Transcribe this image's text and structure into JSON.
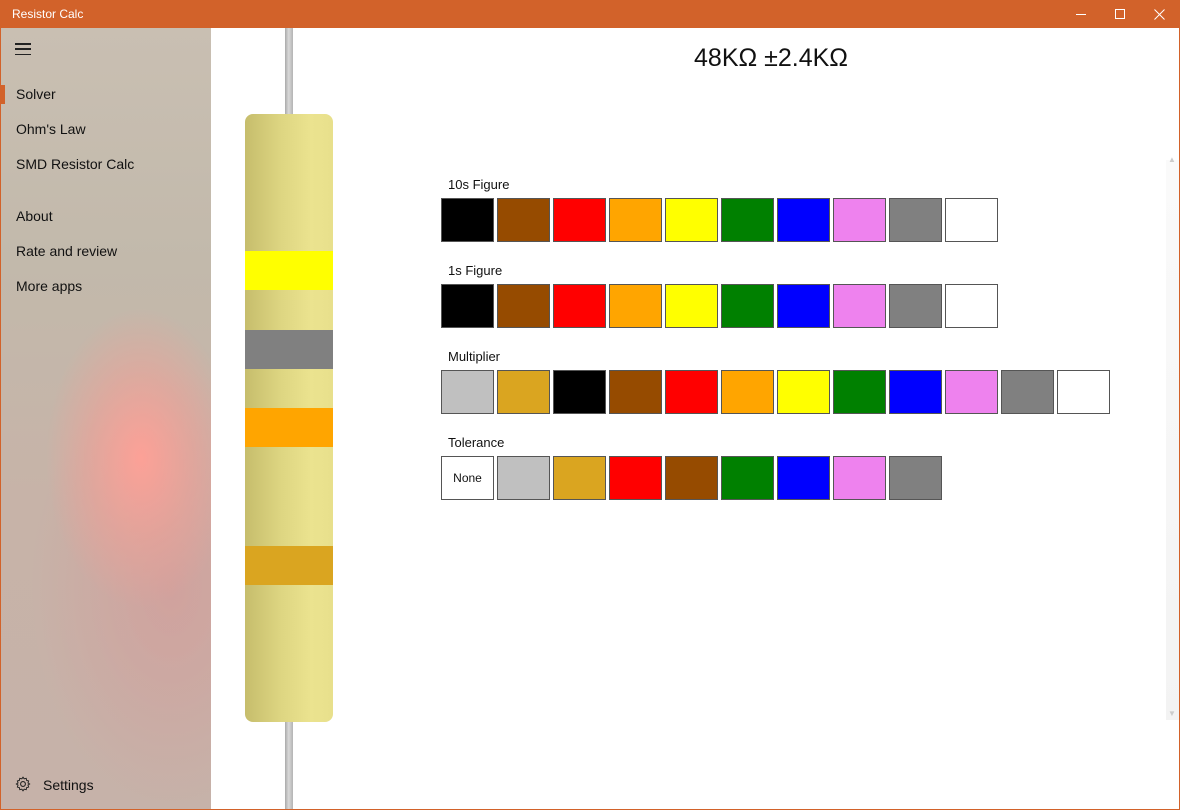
{
  "window": {
    "title": "Resistor Calc",
    "accent_color": "#d2622a"
  },
  "nav": {
    "menu_icon": "hamburger-icon",
    "items": [
      {
        "label": "Solver",
        "selected": true
      },
      {
        "label": "Ohm's Law",
        "selected": false
      },
      {
        "label": "SMD Resistor Calc",
        "selected": false
      },
      {
        "label": "About",
        "selected": false
      },
      {
        "label": "Rate and review",
        "selected": false
      },
      {
        "label": "More apps",
        "selected": false
      }
    ],
    "settings": {
      "label": "Settings",
      "icon": "gear-icon"
    }
  },
  "result": {
    "text": "48KΩ ±2.4KΩ"
  },
  "resistor": {
    "body_color": "#e5dd8a",
    "bands": [
      {
        "name": "tens",
        "color": "#ffff00"
      },
      {
        "name": "ones",
        "color": "#808080"
      },
      {
        "name": "multiplier",
        "color": "#ffa500"
      },
      {
        "name": "tolerance",
        "color": "#daa520"
      }
    ]
  },
  "groups": {
    "tens": {
      "label": "10s Figure",
      "swatches": [
        {
          "name": "black",
          "color": "#000000"
        },
        {
          "name": "brown",
          "color": "#964b00"
        },
        {
          "name": "red",
          "color": "#ff0000"
        },
        {
          "name": "orange",
          "color": "#ffa500"
        },
        {
          "name": "yellow",
          "color": "#ffff00"
        },
        {
          "name": "green",
          "color": "#008000"
        },
        {
          "name": "blue",
          "color": "#0000ff"
        },
        {
          "name": "violet",
          "color": "#ee82ee"
        },
        {
          "name": "gray",
          "color": "#808080"
        },
        {
          "name": "white",
          "color": "#ffffff"
        }
      ]
    },
    "ones": {
      "label": "1s Figure",
      "swatches": [
        {
          "name": "black",
          "color": "#000000"
        },
        {
          "name": "brown",
          "color": "#964b00"
        },
        {
          "name": "red",
          "color": "#ff0000"
        },
        {
          "name": "orange",
          "color": "#ffa500"
        },
        {
          "name": "yellow",
          "color": "#ffff00"
        },
        {
          "name": "green",
          "color": "#008000"
        },
        {
          "name": "blue",
          "color": "#0000ff"
        },
        {
          "name": "violet",
          "color": "#ee82ee"
        },
        {
          "name": "gray",
          "color": "#808080"
        },
        {
          "name": "white",
          "color": "#ffffff"
        }
      ]
    },
    "multiplier": {
      "label": "Multiplier",
      "swatches": [
        {
          "name": "silver",
          "color": "#c0c0c0"
        },
        {
          "name": "gold",
          "color": "#daa520"
        },
        {
          "name": "black",
          "color": "#000000"
        },
        {
          "name": "brown",
          "color": "#964b00"
        },
        {
          "name": "red",
          "color": "#ff0000"
        },
        {
          "name": "orange",
          "color": "#ffa500"
        },
        {
          "name": "yellow",
          "color": "#ffff00"
        },
        {
          "name": "green",
          "color": "#008000"
        },
        {
          "name": "blue",
          "color": "#0000ff"
        },
        {
          "name": "violet",
          "color": "#ee82ee"
        },
        {
          "name": "gray",
          "color": "#808080"
        },
        {
          "name": "white",
          "color": "#ffffff"
        }
      ]
    },
    "tolerance": {
      "label": "Tolerance",
      "swatches": [
        {
          "name": "none",
          "color": "#ffffff",
          "label": "None"
        },
        {
          "name": "silver",
          "color": "#c0c0c0"
        },
        {
          "name": "gold",
          "color": "#daa520"
        },
        {
          "name": "red",
          "color": "#ff0000"
        },
        {
          "name": "brown",
          "color": "#964b00"
        },
        {
          "name": "green",
          "color": "#008000"
        },
        {
          "name": "blue",
          "color": "#0000ff"
        },
        {
          "name": "violet",
          "color": "#ee82ee"
        },
        {
          "name": "gray",
          "color": "#808080"
        }
      ]
    }
  }
}
